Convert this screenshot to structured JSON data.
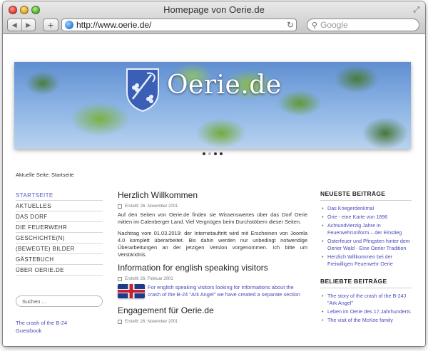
{
  "window": {
    "title": "Homepage von Oerie.de",
    "url": "http://www.oerie.de/",
    "search_placeholder": "Google"
  },
  "banner": {
    "site_title": "Oerie.de"
  },
  "breadcrumb": "Aktuelle Seite: Startseite",
  "sidebar": {
    "items": [
      {
        "label": "STARTSEITE"
      },
      {
        "label": "AKTUELLES"
      },
      {
        "label": "DAS DORF"
      },
      {
        "label": "DIE FEUERWEHR"
      },
      {
        "label": "GESCHICHTE(N)"
      },
      {
        "label": "(BEWEGTE) BILDER"
      },
      {
        "label": "GÄSTEBUCH"
      },
      {
        "label": "ÜBER OERIE.DE"
      }
    ],
    "search_placeholder": "Suchen ...",
    "link1": "The crash of the B-24",
    "link2": "Guestbook"
  },
  "main": {
    "articles": [
      {
        "title": "Herzlich Willkommen",
        "meta": "Erstellt: 26. November 2001",
        "p1": "Auf den Seiten von Oerie.de finden sie Wissenswertes über das Dorf Oerie mitten im Calenberger Land. Viel Vergnügen beim Durchstöbern dieser Seiten.",
        "p2": "Nachtrag vom 01.03.2019: der Internetauftritt wird mit Erscheinen von Joomla 4.0 komplett überarbeitet. Bis dahin werden nur unbedingt notwendige Überarbeitungen an der jetzigen Version vorgenommen. Ich bitte um Verständnis."
      },
      {
        "title": "Information for english speaking visitors",
        "meta": "Erstellt: 26. Februar 2001",
        "link": "For english speaking visitors looking for informations about the crash of the B-24 \"Ark Angel\" we have created a separate section"
      },
      {
        "title": "Engagement für Oerie.de",
        "meta": "Erstellt: 26. November 2001"
      }
    ]
  },
  "right": {
    "newest_heading": "NEUESTE BEITRÄGE",
    "newest": [
      "Das Kriegerdenkmal",
      "Örie - eine Karte von 1896",
      "Achtundvierzig Jahre in Feuerwehruniform – der Einstieg",
      "Osterfeuer und Pfingsten hinter dem Oerier Wald - Eine Oerier Tradition",
      "Herzlich Willkommen bei der Freiwilligen Feuerwehr Oerie"
    ],
    "popular_heading": "BELIEBTE BEITRÄGE",
    "popular": [
      "The story of the crash of the B-24J \"Ark Angel\"",
      "Leben im Oerie des 17.Jahrhunderts",
      "The visit of the McKee family"
    ]
  }
}
